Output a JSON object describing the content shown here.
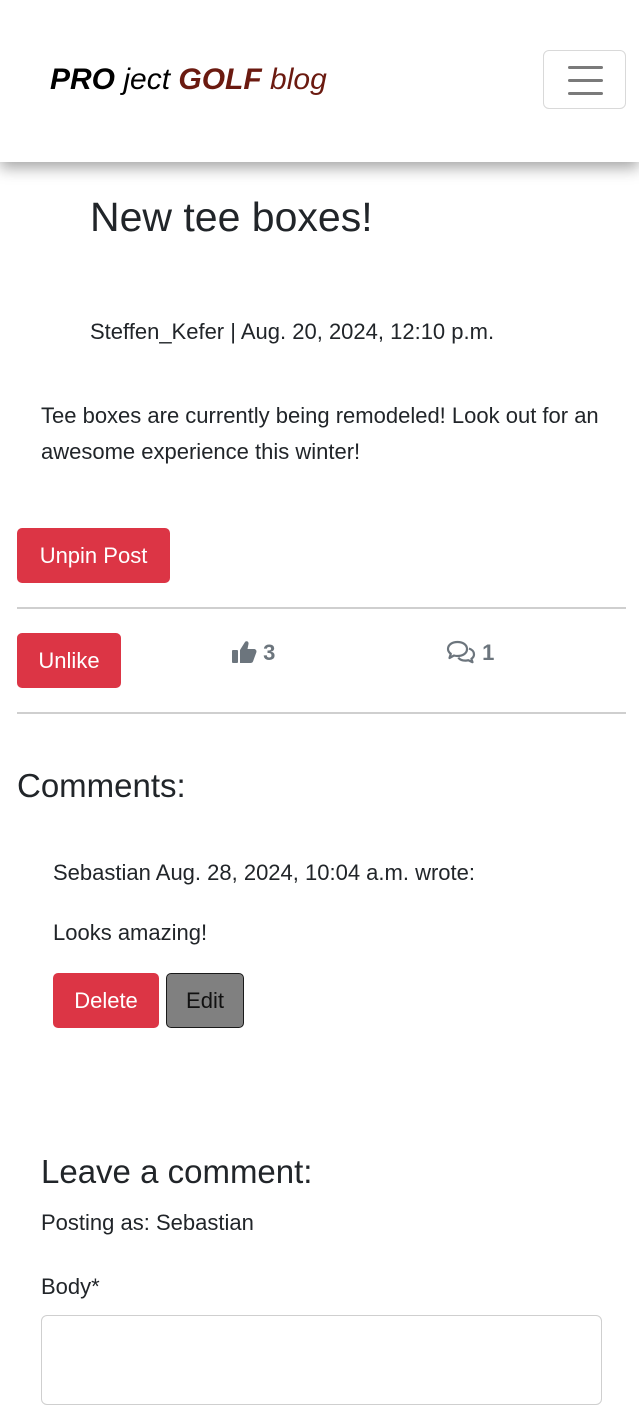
{
  "navbar": {
    "brand_part1": "PRO",
    "brand_part2": " ject ",
    "brand_part3": "GOLF",
    "brand_part4": " blog",
    "toggler_icon": "hamburger-menu-icon"
  },
  "post": {
    "title": "New tee boxes!",
    "author": "Steffen_Kefer",
    "separator": " | ",
    "date": "Aug. 20, 2024, 12:10 p.m.",
    "content": "Tee boxes are currently being remodeled! Look out for an awesome experience this winter!",
    "unpin_label": "Unpin Post",
    "unlike_label": "Unlike",
    "like_count": "3",
    "comment_count": "1",
    "like_icon": "thumbs-up-icon",
    "comment_icon": "comments-icon"
  },
  "comments": {
    "heading": "Comments:",
    "items": [
      {
        "author": "Sebastian",
        "date": "Aug. 28, 2024, 10:04 a.m.",
        "wrote": "wrote:",
        "body": "Looks amazing!",
        "delete_label": "Delete",
        "edit_label": "Edit"
      }
    ]
  },
  "comment_form": {
    "heading": "Leave a comment:",
    "posting_as_label": "Posting as: ",
    "posting_as_user": "Sebastian",
    "body_label": "Body*",
    "body_value": ""
  },
  "colors": {
    "danger": "#dc3545",
    "brand_red": "#6b1a10",
    "muted": "#6c757d",
    "edit_button": "#808080"
  }
}
